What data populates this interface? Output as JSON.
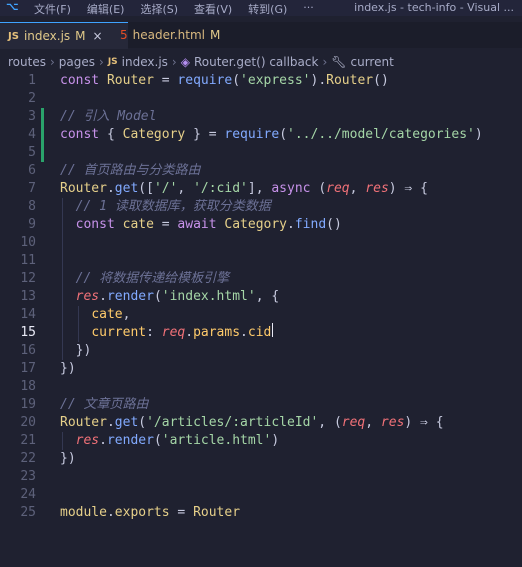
{
  "titlebar": {
    "menu": [
      "文件(F)",
      "编辑(E)",
      "选择(S)",
      "查看(V)",
      "转到(G)",
      "···"
    ],
    "window_title": "index.js - tech-info - Visual ..."
  },
  "tabs": [
    {
      "label": "index.js",
      "status": "M",
      "icon": "js-file-icon",
      "active": true
    },
    {
      "label": "header.html",
      "status": "M",
      "icon": "html-file-icon",
      "active": false
    }
  ],
  "breadcrumb": [
    "routes",
    "pages",
    "index.js",
    "Router.get() callback",
    "current"
  ],
  "editor": {
    "current_line": 15,
    "lines": [
      {
        "n": "1",
        "tokens": [
          [
            "kw",
            "const "
          ],
          [
            "v",
            "Router"
          ],
          [
            "p",
            " = "
          ],
          [
            "fn",
            "require"
          ],
          [
            "p",
            "("
          ],
          [
            "s",
            "'express'"
          ],
          [
            "p",
            ")."
          ],
          [
            "v",
            "Router"
          ],
          [
            "p",
            "()"
          ]
        ]
      },
      {
        "n": "2",
        "tokens": []
      },
      {
        "n": "3",
        "tokens": [
          [
            "c",
            "// 引入 Model"
          ]
        ]
      },
      {
        "n": "4",
        "tokens": [
          [
            "kw",
            "const "
          ],
          [
            "p",
            "{ "
          ],
          [
            "v",
            "Category"
          ],
          [
            "p",
            " } = "
          ],
          [
            "fn",
            "require"
          ],
          [
            "p",
            "("
          ],
          [
            "s",
            "'../../model/categories'"
          ],
          [
            "p",
            ")"
          ]
        ]
      },
      {
        "n": "5",
        "tokens": []
      },
      {
        "n": "6",
        "tokens": [
          [
            "c",
            "// 首页路由与分类路由"
          ]
        ]
      },
      {
        "n": "7",
        "tokens": [
          [
            "v",
            "Router"
          ],
          [
            "p",
            "."
          ],
          [
            "fn",
            "get"
          ],
          [
            "p",
            "(["
          ],
          [
            "s",
            "'/'"
          ],
          [
            "p",
            ", "
          ],
          [
            "s",
            "'/:cid'"
          ],
          [
            "p",
            "], "
          ],
          [
            "kw",
            "async"
          ],
          [
            "p",
            " ("
          ],
          [
            "param",
            "req"
          ],
          [
            "p",
            ", "
          ],
          [
            "param",
            "res"
          ],
          [
            "p",
            ") ⇒ {"
          ]
        ]
      },
      {
        "n": "8",
        "tokens": [
          [
            "c",
            "  // 1 读取数据库，获取分类数据"
          ]
        ]
      },
      {
        "n": "9",
        "tokens": [
          [
            "kw",
            "  const "
          ],
          [
            "v",
            "cate"
          ],
          [
            "p",
            " = "
          ],
          [
            "kw",
            "await "
          ],
          [
            "v",
            "Category"
          ],
          [
            "p",
            "."
          ],
          [
            "fn",
            "find"
          ],
          [
            "p",
            "()"
          ]
        ]
      },
      {
        "n": "10",
        "tokens": []
      },
      {
        "n": "11",
        "tokens": []
      },
      {
        "n": "12",
        "tokens": [
          [
            "c",
            "  // 将数据传递给模板引擎"
          ]
        ]
      },
      {
        "n": "13",
        "tokens": [
          [
            "param",
            "  res"
          ],
          [
            "p",
            "."
          ],
          [
            "fn",
            "render"
          ],
          [
            "p",
            "("
          ],
          [
            "s",
            "'index.html'"
          ],
          [
            "p",
            ", {"
          ]
        ]
      },
      {
        "n": "14",
        "tokens": [
          [
            "p",
            "    "
          ],
          [
            "prop",
            "cate"
          ],
          [
            "p",
            ","
          ]
        ]
      },
      {
        "n": "15",
        "tokens": [
          [
            "p",
            "    "
          ],
          [
            "prop",
            "current"
          ],
          [
            "p",
            ": "
          ],
          [
            "param",
            "req"
          ],
          [
            "p",
            "."
          ],
          [
            "prop",
            "params"
          ],
          [
            "p",
            "."
          ],
          [
            "prop",
            "cid"
          ]
        ]
      },
      {
        "n": "16",
        "tokens": [
          [
            "p",
            "  })"
          ]
        ]
      },
      {
        "n": "17",
        "tokens": [
          [
            "p",
            "})"
          ]
        ]
      },
      {
        "n": "18",
        "tokens": []
      },
      {
        "n": "19",
        "tokens": [
          [
            "c",
            "// 文章页路由"
          ]
        ]
      },
      {
        "n": "20",
        "tokens": [
          [
            "v",
            "Router"
          ],
          [
            "p",
            "."
          ],
          [
            "fn",
            "get"
          ],
          [
            "p",
            "("
          ],
          [
            "s",
            "'/articles/:articleId'"
          ],
          [
            "p",
            ", ("
          ],
          [
            "param",
            "req"
          ],
          [
            "p",
            ", "
          ],
          [
            "param",
            "res"
          ],
          [
            "p",
            ") ⇒ {"
          ]
        ]
      },
      {
        "n": "21",
        "tokens": [
          [
            "param",
            "  res"
          ],
          [
            "p",
            "."
          ],
          [
            "fn",
            "render"
          ],
          [
            "p",
            "("
          ],
          [
            "s",
            "'article.html'"
          ],
          [
            "p",
            ")"
          ]
        ]
      },
      {
        "n": "22",
        "tokens": [
          [
            "p",
            "})"
          ]
        ]
      },
      {
        "n": "23",
        "tokens": []
      },
      {
        "n": "24",
        "tokens": []
      },
      {
        "n": "25",
        "tokens": [
          [
            "v",
            "module"
          ],
          [
            "p",
            "."
          ],
          [
            "v",
            "exports"
          ],
          [
            "p",
            " = "
          ],
          [
            "v",
            "Router"
          ]
        ]
      }
    ]
  }
}
